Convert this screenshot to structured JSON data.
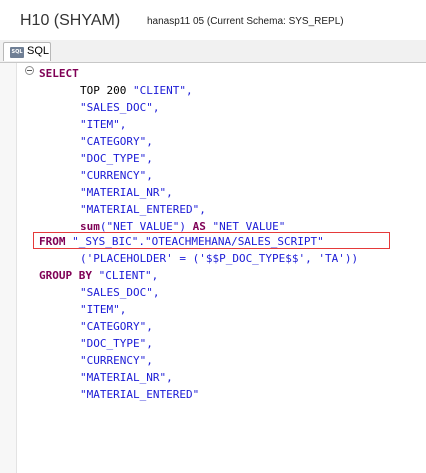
{
  "header": {
    "system": "H10 (SHYAM)",
    "schema_info": "hanasp11 05 (Current Schema: SYS_REPL)"
  },
  "tab": {
    "label": "SQL",
    "icon": "sql-file-icon"
  },
  "code": {
    "select_kw": "SELECT",
    "top_kw": "TOP 200",
    "client": "\"CLIENT\",",
    "sales_doc": "\"SALES_DOC\",",
    "item": "\"ITEM\",",
    "category": "\"CATEGORY\",",
    "doc_type": "\"DOC_TYPE\",",
    "currency": "\"CURRENCY\",",
    "material_nr": "\"MATERIAL_NR\",",
    "material_entered": "\"MATERIAL_ENTERED\",",
    "sum_kw": "sum",
    "sum_arg": "(\"NET_VALUE\")",
    "as_kw": "AS",
    "as_alias": "\"NET_VALUE\"",
    "from_kw": "FROM",
    "from_target": "\"_SYS_BIC\".\"OTEACHMEHANA/SALES_SCRIPT\"",
    "placeholder": "('PLACEHOLDER' = ('$$P_DOC_TYPE$$', 'TA'))",
    "group_by_kw": "GROUP BY",
    "gb_client": "\"CLIENT\",",
    "gb_sales_doc": "\"SALES_DOC\",",
    "gb_item": "\"ITEM\",",
    "gb_category": "\"CATEGORY\",",
    "gb_doc_type": "\"DOC_TYPE\",",
    "gb_currency": "\"CURRENCY\",",
    "gb_material_nr": "\"MATERIAL_NR\",",
    "gb_material_entered": "\"MATERIAL_ENTERED\""
  },
  "colors": {
    "keyword": "#7f0055",
    "string": "#1b1bd6",
    "highlight_border": "#e53a3a"
  }
}
